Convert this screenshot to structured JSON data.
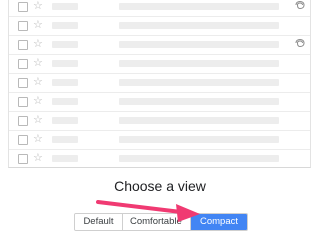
{
  "inbox": {
    "row_count": 9,
    "rows": [
      {
        "star": "☆",
        "has_attachment": true
      },
      {
        "star": "☆",
        "has_attachment": false
      },
      {
        "star": "☆",
        "has_attachment": true
      },
      {
        "star": "☆",
        "has_attachment": false
      },
      {
        "star": "☆",
        "has_attachment": false
      },
      {
        "star": "☆",
        "has_attachment": false
      },
      {
        "star": "☆",
        "has_attachment": false
      },
      {
        "star": "☆",
        "has_attachment": false
      },
      {
        "star": "☆",
        "has_attachment": false
      }
    ]
  },
  "view_picker": {
    "title": "Choose a view",
    "options": [
      {
        "label": "Default",
        "selected": false
      },
      {
        "label": "Comfortable",
        "selected": false
      },
      {
        "label": "Compact",
        "selected": true
      }
    ]
  },
  "colors": {
    "accent": "#4285f4",
    "arrow": "#f03a72",
    "placeholder": "#ededed"
  }
}
